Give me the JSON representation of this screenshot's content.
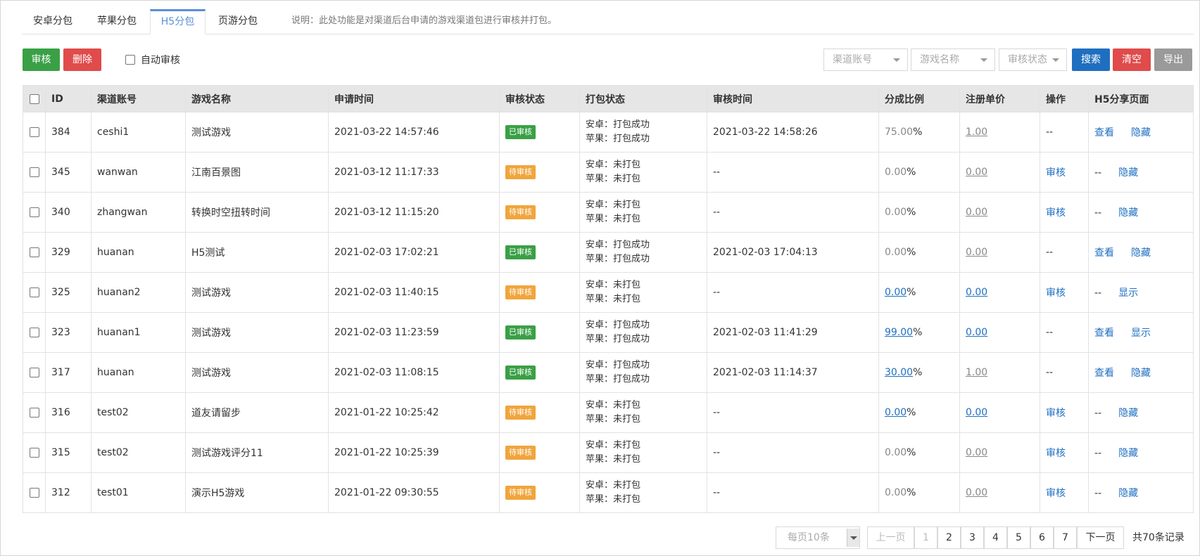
{
  "tabs": [
    {
      "label": "安卓分包"
    },
    {
      "label": "苹果分包"
    },
    {
      "label": "H5分包"
    },
    {
      "label": "页游分包"
    }
  ],
  "tab_note": "说明：此处功能是对渠道后台申请的游戏渠道包进行审核并打包。",
  "toolbar": {
    "audit_label": "审核",
    "delete_label": "删除",
    "auto_audit_label": "自动审核",
    "channel_placeholder": "渠道账号",
    "game_placeholder": "游戏名称",
    "status_placeholder": "审核状态",
    "search_label": "搜索",
    "clear_label": "清空",
    "export_label": "导出"
  },
  "table": {
    "headers": [
      "ID",
      "渠道账号",
      "游戏名称",
      "申请时间",
      "审核状态",
      "打包状态",
      "审核时间",
      "分成比例",
      "注册单价",
      "操作",
      "H5分享页面"
    ],
    "rows": [
      {
        "id": "384",
        "account": "ceshi1",
        "game": "测试游戏",
        "apply_time": "2021-03-22 14:57:46",
        "status": "已审核",
        "android": "安卓：打包成功",
        "ios": "苹果：打包成功",
        "audit_time": "2021-03-22 14:58:26",
        "ratio": "75.00",
        "price": "1.00",
        "op": "--",
        "view": "查看",
        "toggle": "隐藏"
      },
      {
        "id": "345",
        "account": "wanwan",
        "game": "江南百景图",
        "apply_time": "2021-03-12 11:17:33",
        "status": "待审核",
        "android": "安卓：未打包",
        "ios": "苹果：未打包",
        "audit_time": "--",
        "ratio": "0.00",
        "price": "0.00",
        "op": "审核",
        "view": "--",
        "toggle": "隐藏"
      },
      {
        "id": "340",
        "account": "zhangwan",
        "game": "转换时空扭转时间",
        "apply_time": "2021-03-12 11:15:20",
        "status": "待审核",
        "android": "安卓：未打包",
        "ios": "苹果：未打包",
        "audit_time": "--",
        "ratio": "0.00",
        "price": "0.00",
        "op": "审核",
        "view": "--",
        "toggle": "隐藏"
      },
      {
        "id": "329",
        "account": "huanan",
        "game": "H5测试",
        "apply_time": "2021-02-03 17:02:21",
        "status": "已审核",
        "android": "安卓：打包成功",
        "ios": "苹果：打包成功",
        "audit_time": "2021-02-03 17:04:13",
        "ratio": "0.00",
        "price": "0.00",
        "op": "--",
        "view": "查看",
        "toggle": "隐藏"
      },
      {
        "id": "325",
        "account": "huanan2",
        "game": "测试游戏",
        "apply_time": "2021-02-03 11:40:15",
        "status": "待审核",
        "android": "安卓：未打包",
        "ios": "苹果：未打包",
        "audit_time": "--",
        "ratio": "0.00",
        "price": "0.00",
        "op": "审核",
        "view": "--",
        "toggle": "显示"
      },
      {
        "id": "323",
        "account": "huanan1",
        "game": "测试游戏",
        "apply_time": "2021-02-03 11:23:59",
        "status": "已审核",
        "android": "安卓：打包成功",
        "ios": "苹果：打包成功",
        "audit_time": "2021-02-03 11:41:29",
        "ratio": "99.00",
        "price": "0.00",
        "op": "--",
        "view": "查看",
        "toggle": "显示"
      },
      {
        "id": "317",
        "account": "huanan",
        "game": "测试游戏",
        "apply_time": "2021-02-03 11:08:15",
        "status": "已审核",
        "android": "安卓：打包成功",
        "ios": "苹果：打包成功",
        "audit_time": "2021-02-03 11:14:37",
        "ratio": "30.00",
        "price": "1.00",
        "op": "--",
        "view": "查看",
        "toggle": "隐藏"
      },
      {
        "id": "316",
        "account": "test02",
        "game": "道友请留步",
        "apply_time": "2021-01-22 10:25:42",
        "status": "待审核",
        "android": "安卓：未打包",
        "ios": "苹果：未打包",
        "audit_time": "--",
        "ratio": "0.00",
        "price": "0.00",
        "op": "审核",
        "view": "--",
        "toggle": "隐藏"
      },
      {
        "id": "315",
        "account": "test02",
        "game": "测试游戏评分11",
        "apply_time": "2021-01-22 10:25:39",
        "status": "待审核",
        "android": "安卓：未打包",
        "ios": "苹果：未打包",
        "audit_time": "--",
        "ratio": "0.00",
        "price": "0.00",
        "op": "审核",
        "view": "--",
        "toggle": "隐藏"
      },
      {
        "id": "312",
        "account": "test01",
        "game": "演示H5游戏",
        "apply_time": "2021-01-22 09:30:55",
        "status": "待审核",
        "android": "安卓：未打包",
        "ios": "苹果：未打包",
        "audit_time": "--",
        "ratio": "0.00",
        "price": "0.00",
        "op": "审核",
        "view": "--",
        "toggle": "隐藏"
      }
    ]
  },
  "pagination": {
    "per_page": "每页10条",
    "prev": "上一页",
    "pages": [
      "1",
      "2",
      "3",
      "4",
      "5",
      "6",
      "7"
    ],
    "next": "下一页",
    "total": "共70条记录"
  },
  "colors": {
    "accent": "#1f6fc1",
    "success": "#3aa046",
    "danger": "#e04b4b",
    "warning": "#f0a53c",
    "tab_active": "#5a8fd6"
  }
}
